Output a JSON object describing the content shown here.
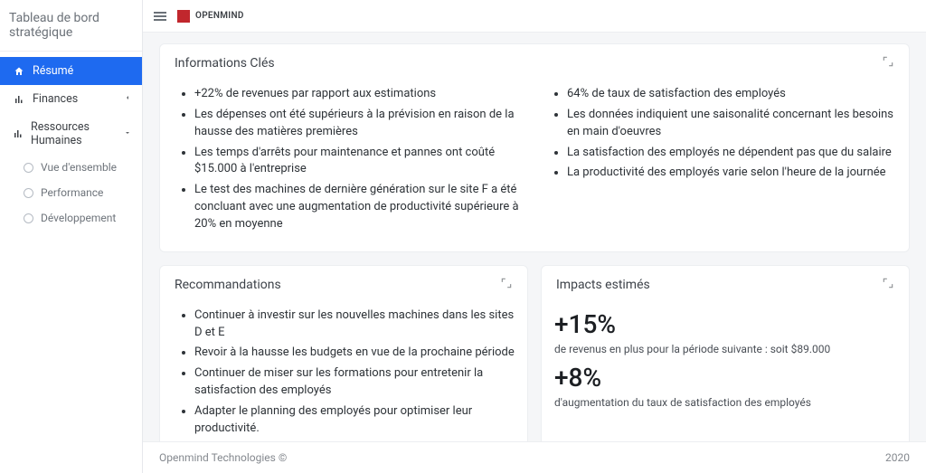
{
  "app": {
    "title": "Tableau de bord stratégique"
  },
  "brand": {
    "name": "OPENMIND"
  },
  "nav": {
    "items": [
      {
        "label": "Résumé",
        "icon": "home-icon",
        "active": true
      },
      {
        "label": "Finances",
        "icon": "chart-icon",
        "caret": "left"
      },
      {
        "label": "Ressources Humaines",
        "icon": "chart-icon",
        "caret": "down",
        "children": [
          {
            "label": "Vue d'ensemble"
          },
          {
            "label": "Performance"
          },
          {
            "label": "Développement"
          }
        ]
      }
    ]
  },
  "cards": {
    "key_info": {
      "title": "Informations Clés",
      "left": [
        "+22% de revenues par rapport aux estimations",
        "Les dépenses ont été supérieurs à la prévision en raison de la hausse des matières premières",
        "Les temps d'arrêts pour maintenance et pannes ont coûté $15.000 à l'entreprise",
        "Le test des machines de dernière génération sur le site F a été concluant avec une augmentation de productivité supérieure à 20% en moyenne"
      ],
      "right": [
        "64% de taux de satisfaction des employés",
        "Les données indiquient une saisonalité concernant les besoins en main d'oeuvres",
        "La satisfaction des employés ne dépendent pas que du salaire",
        "La productivité des employés varie selon l'heure de la journée"
      ]
    },
    "recommendations": {
      "title": "Recommandations",
      "items": [
        "Continuer à investir sur les nouvelles machines dans les sites D et E",
        "Revoir à la hausse les budgets en vue de la prochaine période",
        "Continuer de miser sur les formations pour entretenir la satisfaction des employés",
        "Adapter le planning des employés pour optimiser leur productivité."
      ]
    },
    "impacts": {
      "title": "Impacts estimés",
      "entries": [
        {
          "figure": "+15%",
          "caption": "de revenus en plus pour la période suivante : soit $89.000"
        },
        {
          "figure": "+8%",
          "caption": "d'augmentation du taux de satisfaction des employés"
        }
      ]
    }
  },
  "footer": {
    "copyright": "Openmind Technologies ©",
    "year": "2020"
  }
}
